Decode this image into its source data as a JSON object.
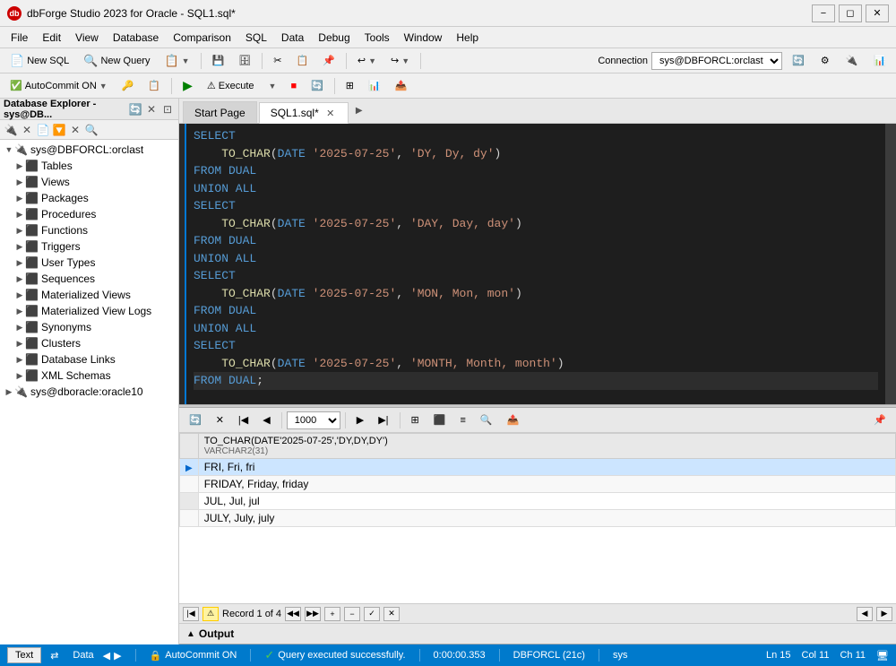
{
  "titleBar": {
    "title": "dbForge Studio 2023 for Oracle - SQL1.sql*",
    "logoText": "db",
    "controls": [
      "minimize",
      "restore",
      "close"
    ]
  },
  "menuBar": {
    "items": [
      "File",
      "Edit",
      "View",
      "Database",
      "Comparison",
      "SQL",
      "Data",
      "Debug",
      "Tools",
      "Window",
      "Help"
    ]
  },
  "toolbar1": {
    "newSql": "New SQL",
    "newQuery": "New Query",
    "connection": "Connection",
    "connectionValue": "sys@DBFORCL:orclast"
  },
  "toolbar2": {
    "autoCommit": "AutoCommit ON",
    "execute": "Execute"
  },
  "dbExplorer": {
    "title": "Database Explorer - sys@DB...",
    "tree": [
      {
        "level": 0,
        "expanded": true,
        "label": "sys@DBFORCL:orclast",
        "icon": "🔌",
        "type": "connection"
      },
      {
        "level": 1,
        "expanded": false,
        "label": "Tables",
        "icon": "📋",
        "type": "folder"
      },
      {
        "level": 1,
        "expanded": false,
        "label": "Views",
        "icon": "👁",
        "type": "folder"
      },
      {
        "level": 1,
        "expanded": false,
        "label": "Packages",
        "icon": "📦",
        "type": "folder"
      },
      {
        "level": 1,
        "expanded": false,
        "label": "Procedures",
        "icon": "⚙",
        "type": "folder"
      },
      {
        "level": 1,
        "expanded": false,
        "label": "Functions",
        "icon": "𝑓",
        "type": "folder"
      },
      {
        "level": 1,
        "expanded": false,
        "label": "Triggers",
        "icon": "⚡",
        "type": "folder"
      },
      {
        "level": 1,
        "expanded": false,
        "label": "User Types",
        "icon": "🔷",
        "type": "folder"
      },
      {
        "level": 1,
        "expanded": false,
        "label": "Sequences",
        "icon": "🔢",
        "type": "folder"
      },
      {
        "level": 1,
        "expanded": false,
        "label": "Materialized Views",
        "icon": "📋",
        "type": "folder"
      },
      {
        "level": 1,
        "expanded": false,
        "label": "Materialized View Logs",
        "icon": "📋",
        "type": "folder"
      },
      {
        "level": 1,
        "expanded": false,
        "label": "Synonyms",
        "icon": "🔗",
        "type": "folder"
      },
      {
        "level": 1,
        "expanded": false,
        "label": "Clusters",
        "icon": "🗄",
        "type": "folder"
      },
      {
        "level": 1,
        "expanded": false,
        "label": "Database Links",
        "icon": "🔗",
        "type": "folder"
      },
      {
        "level": 1,
        "expanded": false,
        "label": "XML Schemas",
        "icon": "📄",
        "type": "folder"
      },
      {
        "level": 0,
        "expanded": false,
        "label": "sys@dboracle:oracle10",
        "icon": "🔌",
        "type": "connection"
      }
    ]
  },
  "tabs": {
    "startPage": "Start Page",
    "sqlFile": "SQL1.sql*"
  },
  "editor": {
    "lines": [
      {
        "text": "SELECT",
        "type": "keyword",
        "indent": 0
      },
      {
        "text": "    TO_CHAR(DATE '2025-07-25', 'DY, Dy, dy')",
        "type": "mixed",
        "indent": 4
      },
      {
        "text": "FROM DUAL",
        "type": "keyword",
        "indent": 0
      },
      {
        "text": "UNION ALL",
        "type": "keyword",
        "indent": 0
      },
      {
        "text": "SELECT",
        "type": "keyword",
        "indent": 0
      },
      {
        "text": "    TO_CHAR(DATE '2025-07-25', 'DAY, Day, day')",
        "type": "mixed",
        "indent": 4
      },
      {
        "text": "FROM DUAL",
        "type": "keyword",
        "indent": 0
      },
      {
        "text": "UNION ALL",
        "type": "keyword",
        "indent": 0
      },
      {
        "text": "SELECT",
        "type": "keyword",
        "indent": 0
      },
      {
        "text": "    TO_CHAR(DATE '2025-07-25', 'MON, Mon, mon')",
        "type": "mixed",
        "indent": 4
      },
      {
        "text": "FROM DUAL",
        "type": "keyword",
        "indent": 0
      },
      {
        "text": "UNION ALL",
        "type": "keyword",
        "indent": 0
      },
      {
        "text": "SELECT",
        "type": "keyword",
        "indent": 0
      },
      {
        "text": "    TO_CHAR(DATE '2025-07-25', 'MONTH, Month, month')",
        "type": "mixed",
        "indent": 4
      },
      {
        "text": "FROM DUAL;",
        "type": "keyword_cursor",
        "indent": 0
      }
    ]
  },
  "results": {
    "columnHeader": "TO_CHAR(DATE'2025-07-25','DY,DY,DY')",
    "columnType": "VARCHAR2(31)",
    "rows": [
      {
        "selected": true,
        "value": "FRI, Fri, fri"
      },
      {
        "selected": false,
        "value": "FRIDAY, Friday, friday"
      },
      {
        "selected": false,
        "value": "JUL, Jul, jul"
      },
      {
        "selected": false,
        "value": "JULY, July, july"
      }
    ],
    "recordInfo": "Record 1 of 4",
    "pageSize": "1000"
  },
  "footer": {
    "textTab": "Text",
    "dataTab": "Data",
    "autoCommit": "AutoCommit ON",
    "successMsg": "Query executed successfully.",
    "execTime": "0:00:00.353",
    "connection": "DBFORCL (21c)",
    "user": "sys"
  },
  "statusBar": {
    "line": "Ln 15",
    "col": "Col 11",
    "ch": "Ch 11"
  },
  "outputBar": {
    "label": "Output"
  }
}
